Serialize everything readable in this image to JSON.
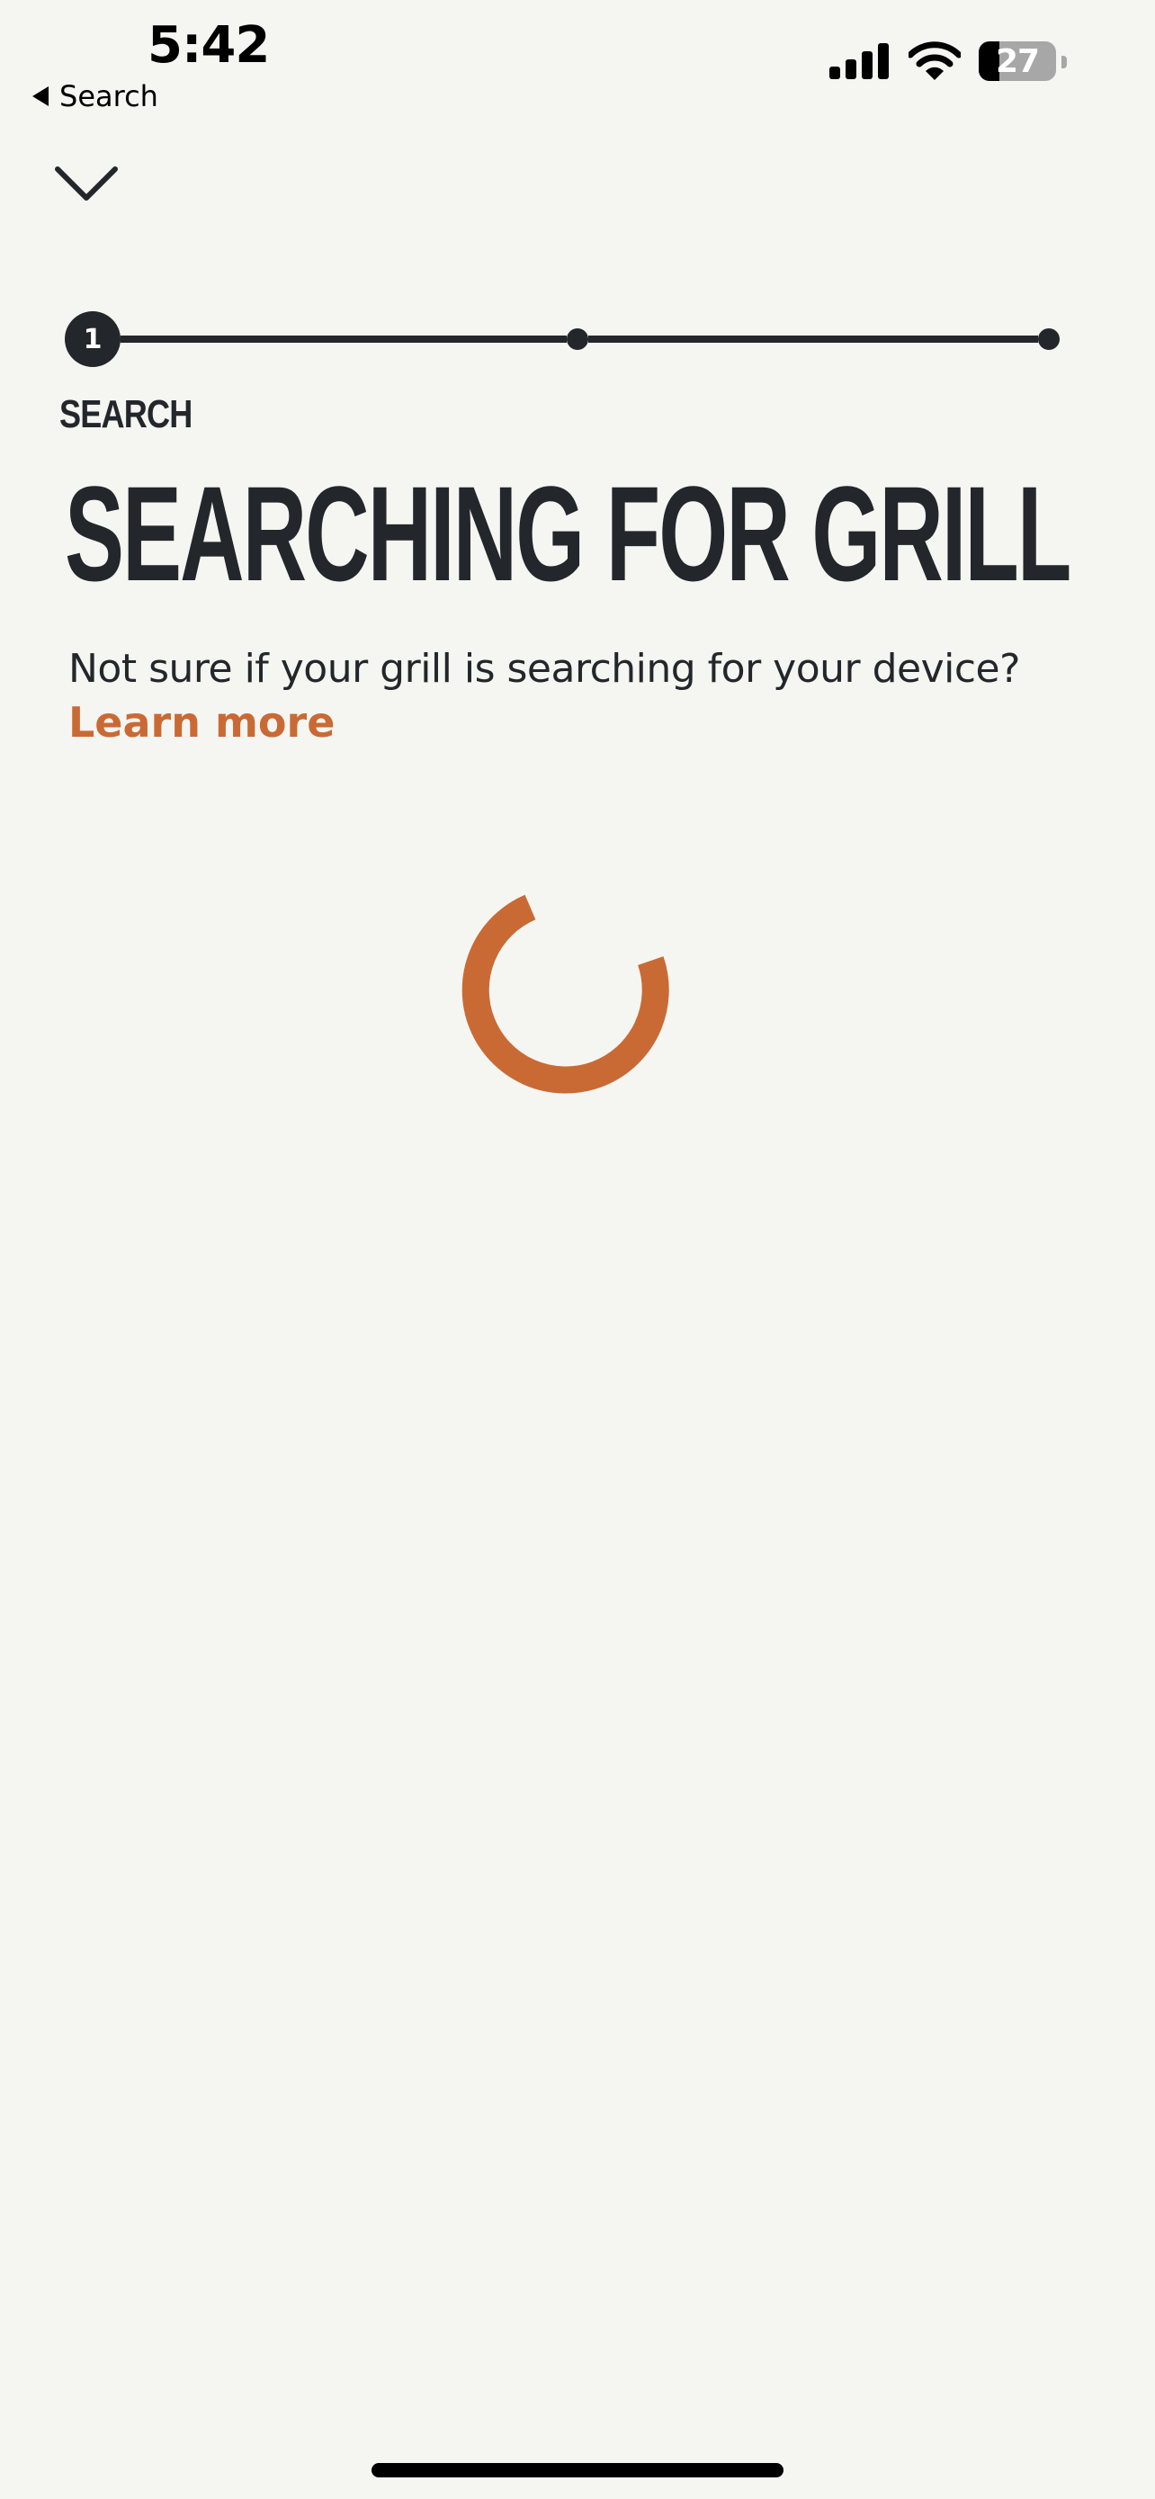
{
  "status_bar": {
    "time": "5:42",
    "back_label": "Search",
    "battery_percent": 27,
    "battery_label": "27"
  },
  "stepper": {
    "current_step": "1",
    "total_steps": 3,
    "current_index": 1
  },
  "content": {
    "step_label": "SEARCH",
    "title": "SEARCHING FOR GRILL",
    "help_text": "Not sure if your grill is searching for your device?",
    "learn_more": "Learn more"
  },
  "colors": {
    "accent": "#c96a35",
    "text": "#23262a",
    "background": "#f5f5f2"
  },
  "icons": {
    "close": "chevron-down-icon",
    "spinner": "loading-spinner-icon"
  }
}
